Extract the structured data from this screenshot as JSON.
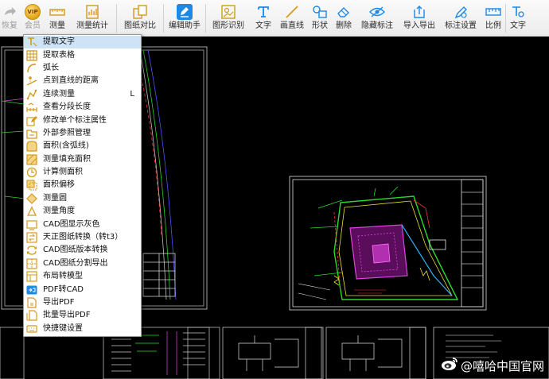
{
  "toolbar": {
    "items": [
      {
        "label": "恢复",
        "icon": "redo-icon",
        "disabled": true
      },
      {
        "label": "会员",
        "icon": "vip-icon"
      },
      {
        "label": "测量",
        "icon": "measure-ruler-icon"
      },
      {
        "label": "测量统计",
        "icon": "measure-stats-icon"
      },
      {
        "label": "图纸对比",
        "icon": "compare-icon"
      },
      {
        "label": "编辑助手",
        "icon": "edit-assistant-icon"
      },
      {
        "label": "图形识别",
        "icon": "shape-recognition-icon"
      },
      {
        "label": "文字",
        "icon": "text-icon"
      },
      {
        "label": "画直线",
        "icon": "line-icon"
      },
      {
        "label": "形状",
        "icon": "shape-icon"
      },
      {
        "label": "删除",
        "icon": "eraser-icon"
      },
      {
        "label": "隐藏标注",
        "icon": "hide-annotation-icon"
      },
      {
        "label": "导入导出",
        "icon": "import-export-icon"
      },
      {
        "label": "标注设置",
        "icon": "annotation-settings-icon"
      },
      {
        "label": "比例",
        "icon": "scale-icon"
      },
      {
        "label": "文字",
        "icon": "text-search-icon"
      }
    ],
    "vip_badge": "VIP"
  },
  "menu": {
    "items": [
      {
        "label": "提取文字",
        "icon": "extract-text-icon",
        "selected": true
      },
      {
        "label": "提取表格",
        "icon": "extract-table-icon"
      },
      {
        "label": "弧长",
        "icon": "arc-length-icon"
      },
      {
        "label": "点到直线的距离",
        "icon": "point-line-distance-icon"
      },
      {
        "label": "连续测量",
        "icon": "continuous-measure-icon",
        "shortcut": "L"
      },
      {
        "label": "查看分段长度",
        "icon": "segment-length-icon"
      },
      {
        "label": "修改单个标注属性",
        "icon": "edit-annotation-icon"
      },
      {
        "label": "外部参照管理",
        "icon": "xref-manager-icon"
      },
      {
        "label": "面积(含弧线)",
        "icon": "area-arc-icon"
      },
      {
        "label": "测量填充面积",
        "icon": "fill-area-icon"
      },
      {
        "label": "计算侧面积",
        "icon": "side-area-icon"
      },
      {
        "label": "面积偏移",
        "icon": "area-offset-icon"
      },
      {
        "label": "测量圆",
        "icon": "measure-circle-icon"
      },
      {
        "label": "测量角度",
        "icon": "measure-angle-icon"
      },
      {
        "label": "CAD图显示灰色",
        "icon": "gray-display-icon"
      },
      {
        "label": "天正图纸转换（转t3）",
        "icon": "tangent-convert-icon"
      },
      {
        "label": "CAD图纸版本转换",
        "icon": "version-convert-icon"
      },
      {
        "label": "CAD图纸分割导出",
        "icon": "split-export-icon"
      },
      {
        "label": "布局转模型",
        "icon": "layout-to-model-icon"
      },
      {
        "label": "PDF转CAD",
        "icon": "pdf-to-cad-icon"
      },
      {
        "label": "导出PDF",
        "icon": "export-pdf-icon"
      },
      {
        "label": "批量导出PDF",
        "icon": "batch-export-pdf-icon"
      },
      {
        "label": "快捷键设置",
        "icon": "shortcut-settings-icon"
      }
    ]
  },
  "watermark": {
    "text": "@嘻哈中国官网"
  },
  "colors": {
    "accent": "#1e88e5",
    "icon_gold": "#d29a1c",
    "selected_bg": "#cfe3f7",
    "canvas_bg": "#000000",
    "cad_green": "#2bd92b",
    "cad_magenta": "#e040e0",
    "cad_yellow": "#f0e030",
    "cad_red": "#ff3030"
  }
}
